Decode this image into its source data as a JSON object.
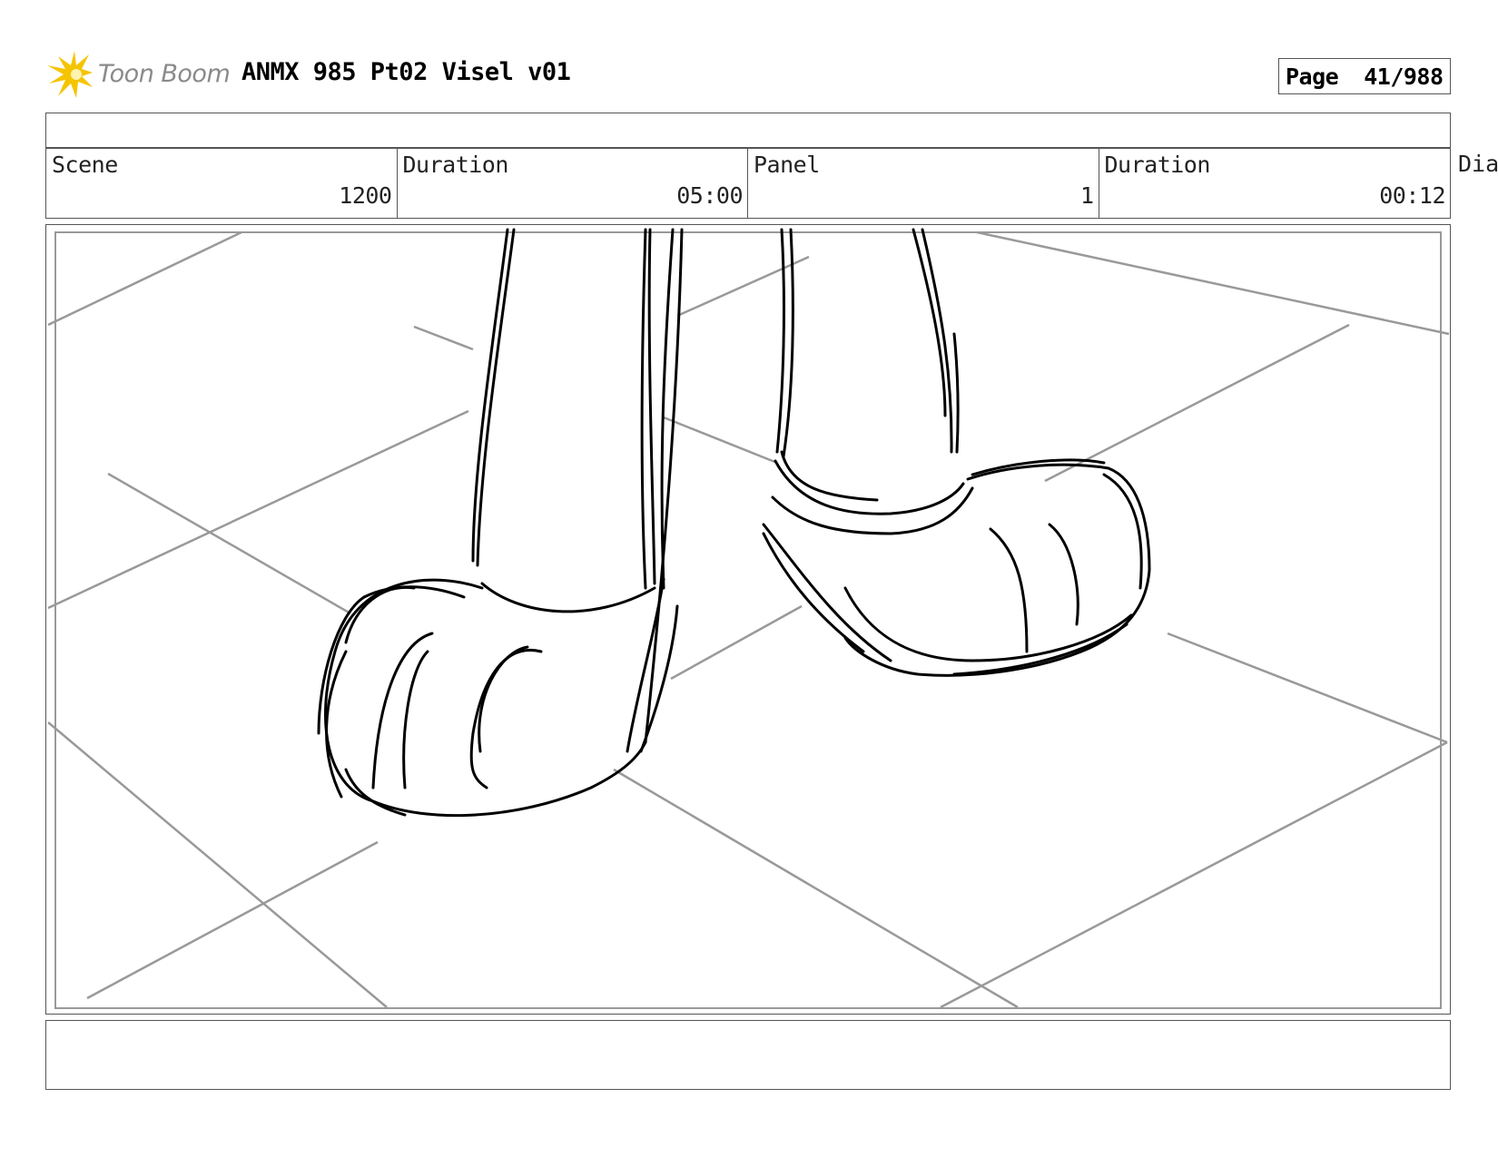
{
  "header": {
    "logo_text": "Toon Boom",
    "title": "ANMX 985 Pt02 Visel v01",
    "page_label": "Page",
    "page_number": "41/988"
  },
  "info": {
    "scene_label": "Scene",
    "scene_value": "1200",
    "scene_duration_label": "Duration",
    "scene_duration_value": "05:00",
    "panel_label": "Panel",
    "panel_value": "1",
    "panel_duration_label": "Duration",
    "panel_duration_value": "00:12",
    "dialogue_label": "Dia"
  },
  "colors": {
    "logo_star": "#f5c400",
    "logo_text": "#8a8a8a",
    "border": "#555555",
    "floor_lines": "#999999",
    "sketch_lines": "#000000"
  }
}
